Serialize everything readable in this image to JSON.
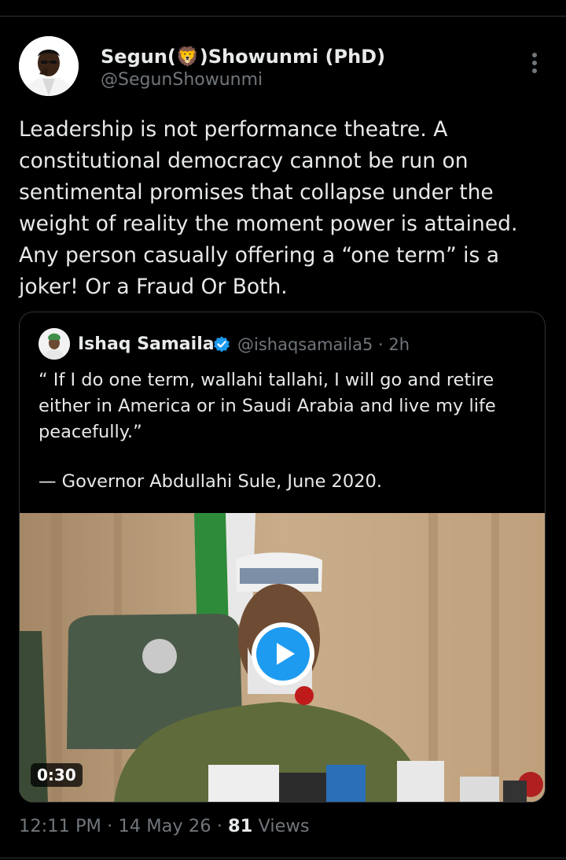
{
  "tweet": {
    "author_name": "Segun(🦁)Showunmi (PhD)",
    "author_handle": "@SegunShowunmi",
    "text": "Leadership is not performance theatre. A\nconstitutional democracy cannot be run on\nsentimental promises that collapse under the\nweight of reality the moment power is attained.\nAny person casually offering a “one term” is a\njoker! Or a Fraud Or Both.",
    "time": "12:11 PM",
    "separator": "·",
    "date": "14 May 26",
    "views_count": "81",
    "views_label": "Views"
  },
  "quote": {
    "author_name": "Ishaq Samaila",
    "author_handle": "@ishaqsamaila5",
    "separator": "·",
    "time": "2h",
    "text": "“ If I do one term, wallahi tallahi, I will go and retire\neither in America or in Saudi Arabia and live my life\npeacefully.”",
    "attribution": "— Governor Abdullahi Sule, June 2020.",
    "video_duration": "0:30"
  },
  "icons": {
    "more": "more-vertical-icon",
    "verified": "verified-badge-icon",
    "play": "play-icon"
  },
  "colors": {
    "background": "#000000",
    "text": "#e7e9ea",
    "secondary_text": "#71767b",
    "accent": "#1d9bf0",
    "border": "#2f3336"
  }
}
